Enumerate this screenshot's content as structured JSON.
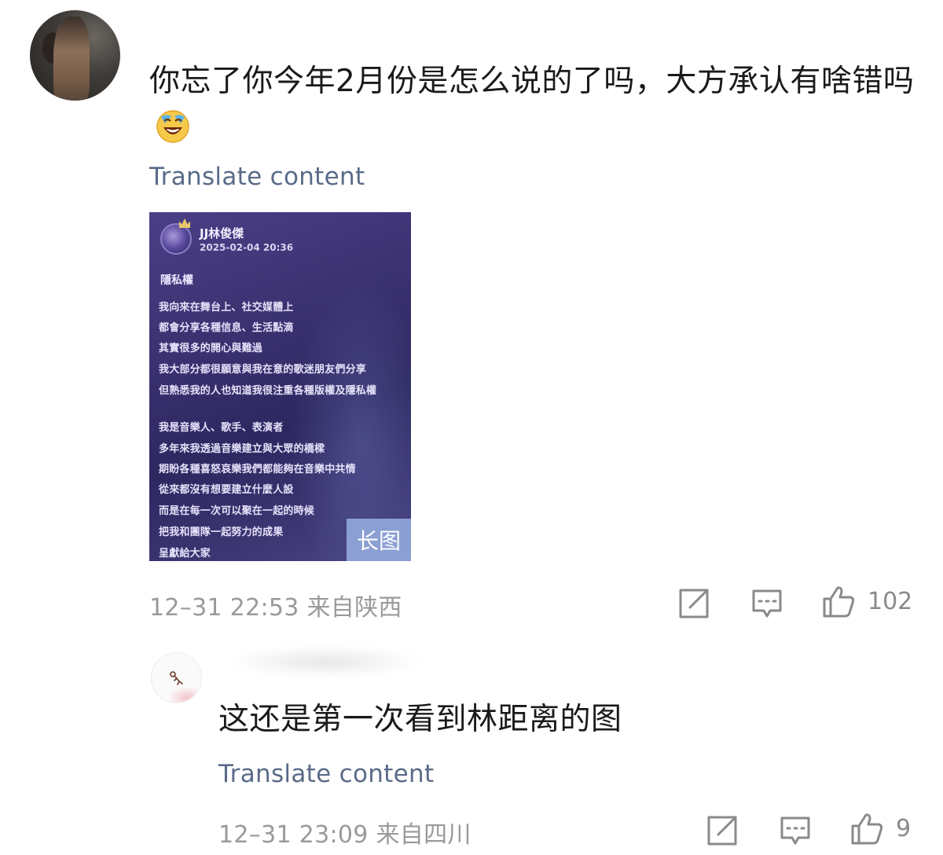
{
  "comment1": {
    "text": "你忘了你今年2月份是怎么说的了吗，大方承认有啥错吗",
    "emoji": "laughing-crying-emoji",
    "translate": "Translate content",
    "image": {
      "poster_name": "JJ林俊傑",
      "poster_date": "2025-02-04 20:36",
      "section": "隱私權",
      "lines": [
        "我向來在舞台上、社交媒體上",
        "都會分享各種信息、生活點滴",
        "其實很多的開心與難過",
        "我大部分都很願意與我在意的歌迷朋友們分享",
        "但熟悉我的人也知道我很注重各種版權及隱私權",
        "我是音樂人、歌手、表演者",
        "多年來我透過音樂建立與大眾的橋樑",
        "期盼各種喜怒哀樂我們都能夠在音樂中共情",
        "從來都沒有想要建立什麼人設",
        "而是在每一次可以聚在一起的時候",
        "把我和團隊一起努力的成果",
        "呈獻給大家"
      ],
      "badge": "长图"
    },
    "meta": "12–31 22:53  来自陕西",
    "like_count": "102"
  },
  "comment2": {
    "text": "这还是第一次看到林距离的图",
    "translate": "Translate content",
    "meta": "12–31 23:09  来自四川",
    "like_count": "9"
  },
  "colors": {
    "translate_link": "#5a6b88",
    "meta_text": "#9a9a9a",
    "icon_stroke": "#8a8a8a"
  }
}
